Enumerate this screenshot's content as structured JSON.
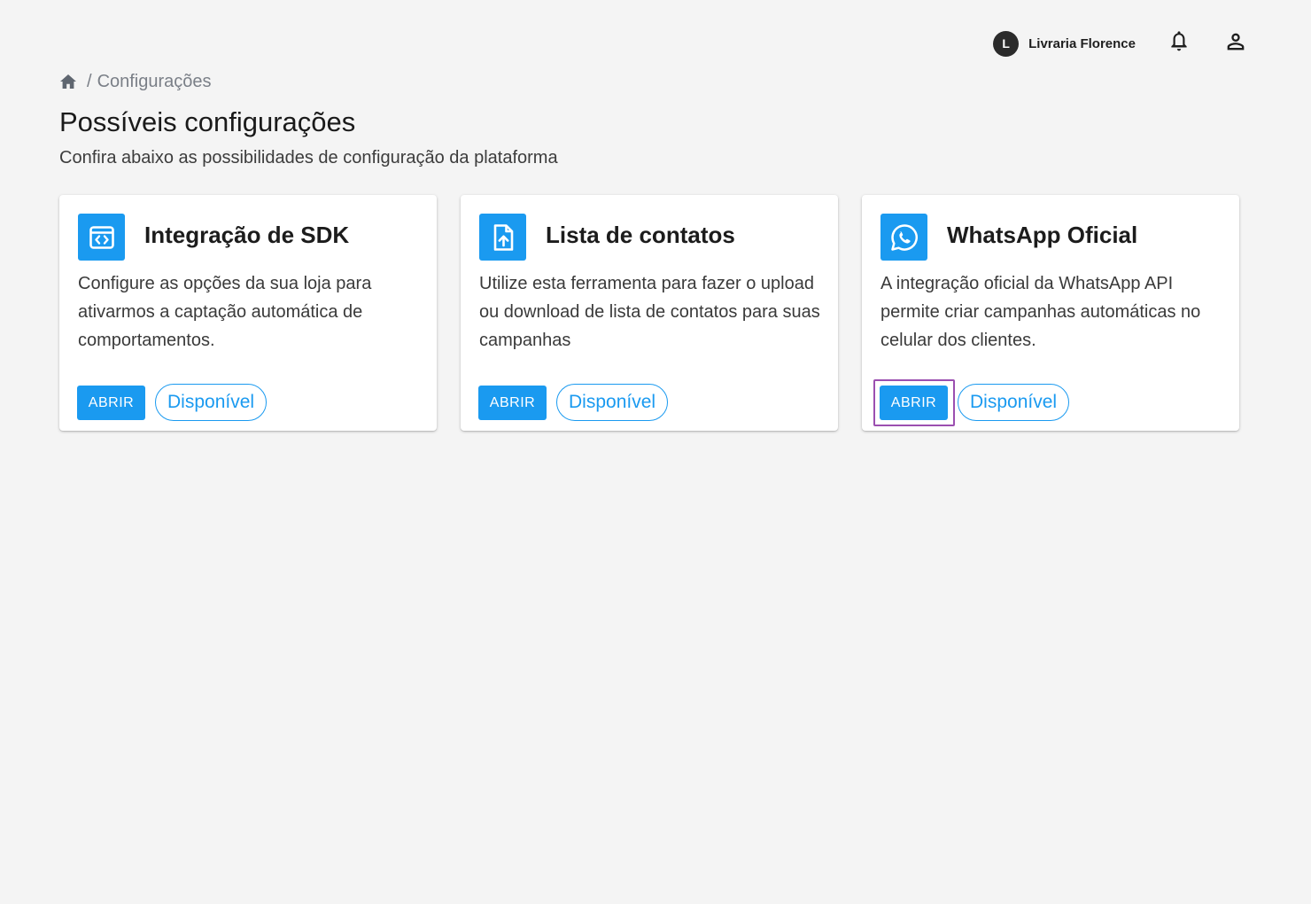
{
  "header": {
    "account": {
      "initial": "L",
      "name": "Livraria Florence"
    },
    "icons": [
      "bell-icon",
      "user-icon"
    ]
  },
  "breadcrumb": {
    "home_icon": "home-icon",
    "separator": "/",
    "current": "Configurações"
  },
  "page": {
    "title": "Possíveis configurações",
    "subtitle": "Confira abaixo as possibilidades de configuração da plataforma"
  },
  "cards": [
    {
      "icon": "code-window-icon",
      "title": "Integração de SDK",
      "description": "Configure as opções da sua loja para ativarmos a captação automática de comportamentos.",
      "button_label": "ABRIR",
      "status": "Disponível"
    },
    {
      "icon": "file-upload-icon",
      "title": "Lista de contatos",
      "description": "Utilize esta ferramenta para fazer o upload ou download de lista de contatos para suas campanhas",
      "button_label": "ABRIR",
      "status": "Disponível"
    },
    {
      "icon": "whatsapp-icon",
      "title": "WhatsApp Oficial",
      "description": "A integração oficial da WhatsApp API permite criar campanhas automáticas no celular dos clientes.",
      "button_label": "ABRIR",
      "status": "Disponível",
      "focused": true
    }
  ],
  "colors": {
    "accent": "#1a9af0",
    "background": "#f4f4f4",
    "focus_outline": "#9b4fb0"
  }
}
